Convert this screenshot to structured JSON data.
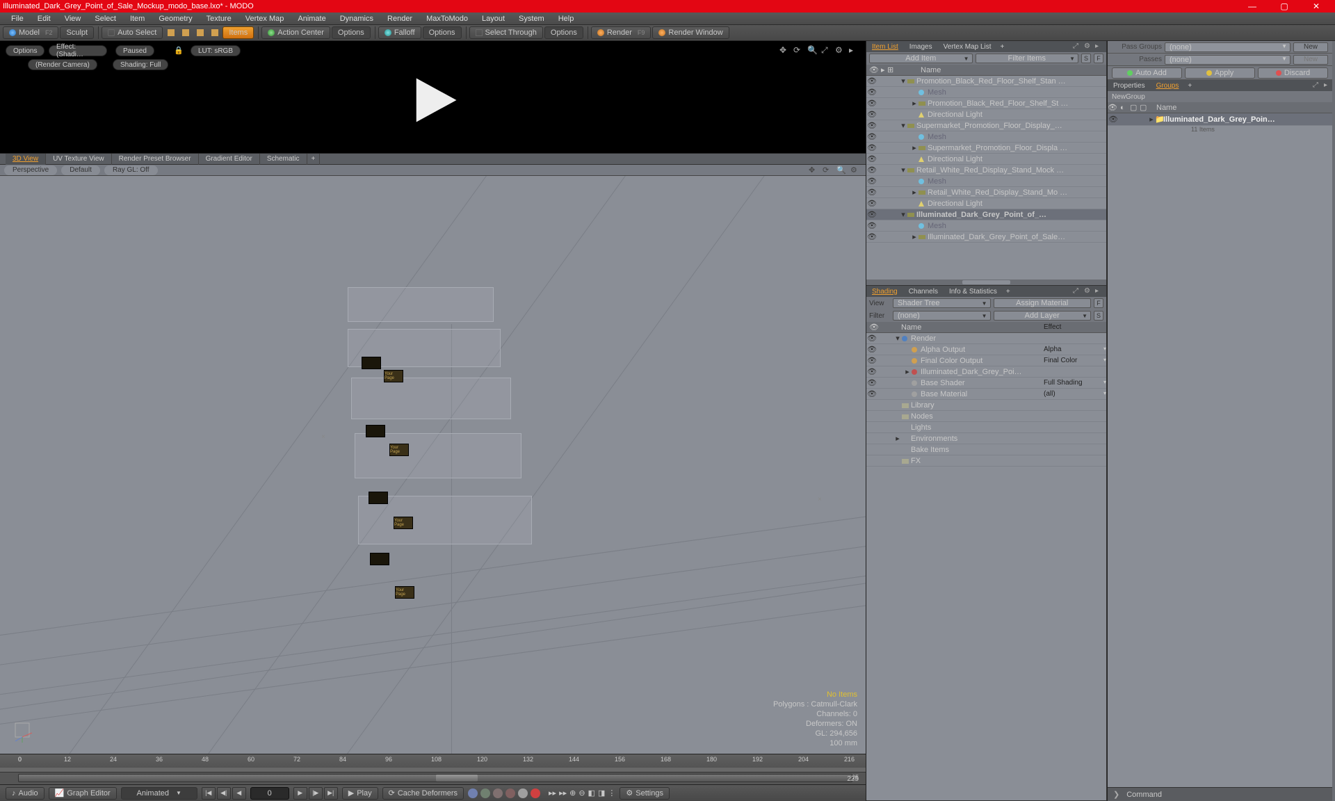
{
  "window": {
    "title": "Illuminated_Dark_Grey_Point_of_Sale_Mockup_modo_base.lxo* - MODO"
  },
  "menubar": [
    "File",
    "Edit",
    "View",
    "Select",
    "Item",
    "Geometry",
    "Texture",
    "Vertex Map",
    "Animate",
    "Dynamics",
    "Render",
    "MaxToModo",
    "Layout",
    "System",
    "Help"
  ],
  "toolbar": {
    "model": "Model",
    "model_key": "F2",
    "sculpt": "Sculpt",
    "autoselect": "Auto Select",
    "items": "Items",
    "action": "Action Center",
    "options1": "Options",
    "falloff": "Falloff",
    "options2": "Options",
    "select_through": "Select Through",
    "options3": "Options",
    "render": "Render",
    "render_key": "F9",
    "render_window": "Render Window"
  },
  "preview": {
    "options": "Options",
    "effect": "Effect: (Shadi…",
    "paused": "Paused",
    "lut": "LUT: sRGB",
    "camera": "(Render Camera)",
    "shading": "Shading: Full"
  },
  "viewtabs": [
    "3D View",
    "UV Texture View",
    "Render Preset Browser",
    "Gradient Editor",
    "Schematic"
  ],
  "viewopts": {
    "persp": "Perspective",
    "default": "Default",
    "raygl": "Ray GL: Off"
  },
  "hud": {
    "noitems": "No Items",
    "poly": "Polygons :  Catmull-Clark",
    "chan": "Channels: 0",
    "def": "Deformers: ON",
    "gl": "GL: 294,656",
    "unit": "100 mm"
  },
  "timeline": {
    "ticks": [
      0,
      12,
      24,
      36,
      48,
      60,
      72,
      84,
      96,
      108,
      120,
      132,
      144,
      156,
      168,
      180,
      192,
      204,
      216
    ],
    "range_start": "0",
    "range_end": "225"
  },
  "bottom": {
    "audio": "Audio",
    "graph": "Graph Editor",
    "animated": "Animated",
    "frame": "0",
    "play": "Play",
    "cache": "Cache Deformers",
    "settings": "Settings"
  },
  "itemlist": {
    "tabs": [
      "Item List",
      "Images",
      "Vertex Map List"
    ],
    "add": "Add Item",
    "filter": "Filter Items",
    "name_hdr": "Name",
    "rows": [
      {
        "d": 1,
        "tw": "▾",
        "ico": "loc",
        "txt": "Promotion_Black_Red_Floor_Shelf_Stan …"
      },
      {
        "d": 2,
        "tw": "",
        "ico": "mesh",
        "txt": "Mesh",
        "grey": true
      },
      {
        "d": 2,
        "tw": "▸",
        "ico": "loc",
        "txt": "Promotion_Black_Red_Floor_Shelf_St …"
      },
      {
        "d": 2,
        "tw": "",
        "ico": "light",
        "txt": "Directional Light"
      },
      {
        "d": 1,
        "tw": "▾",
        "ico": "loc",
        "txt": "Supermarket_Promotion_Floor_Display_…"
      },
      {
        "d": 2,
        "tw": "",
        "ico": "mesh",
        "txt": "Mesh",
        "grey": true
      },
      {
        "d": 2,
        "tw": "▸",
        "ico": "loc",
        "txt": "Supermarket_Promotion_Floor_Displa …"
      },
      {
        "d": 2,
        "tw": "",
        "ico": "light",
        "txt": "Directional Light"
      },
      {
        "d": 1,
        "tw": "▾",
        "ico": "loc",
        "txt": "Retail_White_Red_Display_Stand_Mock …"
      },
      {
        "d": 2,
        "tw": "",
        "ico": "mesh",
        "txt": "Mesh",
        "grey": true
      },
      {
        "d": 2,
        "tw": "▸",
        "ico": "loc",
        "txt": "Retail_White_Red_Display_Stand_Mo …"
      },
      {
        "d": 2,
        "tw": "",
        "ico": "light",
        "txt": "Directional Light"
      },
      {
        "d": 1,
        "tw": "▾",
        "ico": "loc",
        "txt": "Illuminated_Dark_Grey_Point_of_…",
        "sel": true
      },
      {
        "d": 2,
        "tw": "",
        "ico": "mesh",
        "txt": "Mesh",
        "grey": true
      },
      {
        "d": 2,
        "tw": "▸",
        "ico": "loc",
        "txt": "Illuminated_Dark_Grey_Point_of_Sale…"
      }
    ]
  },
  "shading": {
    "tabs": [
      "Shading",
      "Channels",
      "Info & Statistics"
    ],
    "view_lbl": "View",
    "view": "Shader Tree",
    "assign": "Assign Material",
    "filter_lbl": "Filter",
    "filter": "(none)",
    "addlayer": "Add Layer",
    "name_hdr": "Name",
    "eff_hdr": "Effect",
    "rows": [
      {
        "d": 0,
        "tw": "▾",
        "ico": "globe",
        "txt": "Render",
        "eff": ""
      },
      {
        "d": 1,
        "tw": "",
        "ico": "out",
        "txt": "Alpha Output",
        "eff": "Alpha"
      },
      {
        "d": 1,
        "tw": "",
        "ico": "out",
        "txt": "Final Color Output",
        "eff": "Final Color"
      },
      {
        "d": 1,
        "tw": "▸",
        "ico": "mat",
        "txt": "Illuminated_Dark_Grey_Poi…",
        "eff": ""
      },
      {
        "d": 1,
        "tw": "",
        "ico": "shd",
        "txt": "Base Shader",
        "eff": "Full Shading"
      },
      {
        "d": 1,
        "tw": "",
        "ico": "shd",
        "txt": "Base Material",
        "eff": "(all)"
      },
      {
        "d": 0,
        "tw": "",
        "ico": "fold",
        "txt": "Library",
        "eff": ""
      },
      {
        "d": 0,
        "tw": "",
        "ico": "fold",
        "txt": "Nodes",
        "eff": ""
      },
      {
        "d": 0,
        "tw": "",
        "ico": "",
        "txt": "Lights",
        "eff": ""
      },
      {
        "d": 0,
        "tw": "▸",
        "ico": "",
        "txt": "Environments",
        "eff": ""
      },
      {
        "d": 0,
        "tw": "",
        "ico": "",
        "txt": "Bake Items",
        "eff": ""
      },
      {
        "d": 0,
        "tw": "",
        "ico": "fold",
        "txt": "FX",
        "eff": ""
      }
    ]
  },
  "passes": {
    "passgroups": "Pass Groups",
    "passes": "Passes",
    "none": "(none)",
    "new": "New",
    "autoadd": "Auto Add",
    "apply": "Apply",
    "discard": "Discard"
  },
  "groups": {
    "tabs": [
      "Properties",
      "Groups"
    ],
    "newgroup": "NewGroup",
    "name_hdr": "Name",
    "item": "Illuminated_Dark_Grey_Poin…",
    "count": "11 Items"
  },
  "cmd": {
    "label": "Command"
  }
}
